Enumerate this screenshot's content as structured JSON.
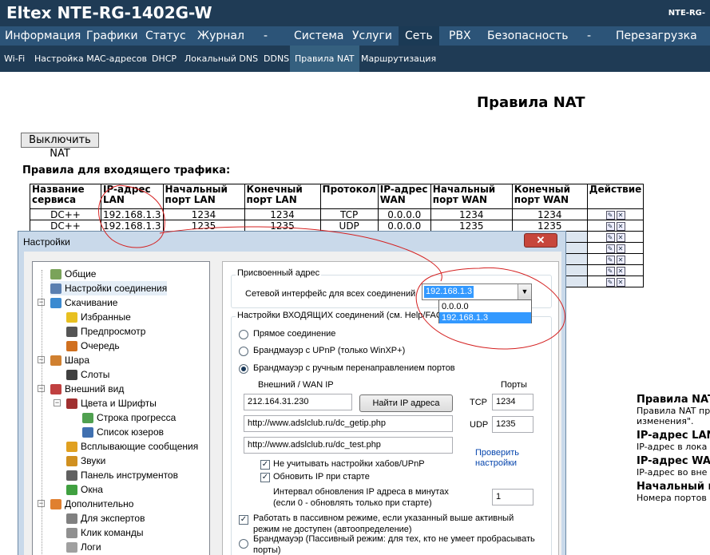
{
  "header": {
    "logo": "Eltex NTE-RG-1402G-W",
    "model_right": "NTE-RG-",
    "main_nav": [
      "Информация",
      "Графики",
      "Статус",
      "Журнал",
      "-",
      "Система",
      "Услуги",
      "Сеть",
      "PBX",
      "Безопасность",
      "-",
      "Перезагрузка"
    ],
    "active_main": "Сеть",
    "sub_nav": [
      "Wi-Fi",
      "Настройка MAC-адресов",
      "DHCP",
      "Локальный DNS",
      "DDNS",
      "Правила NAT",
      "Маршрутизация"
    ],
    "active_sub": "Правила NAT"
  },
  "page": {
    "title": "Правила NAT",
    "nat_off_button": "Выключить NAT",
    "incoming_title": "Правила для входящего трафика:"
  },
  "nat_table": {
    "headers": [
      [
        "Название",
        "сервиса"
      ],
      [
        "IP-адрес",
        "LAN"
      ],
      [
        "Начальный",
        "порт LAN"
      ],
      [
        "Конечный",
        "порт LAN"
      ],
      [
        "Протокол",
        ""
      ],
      [
        "IP-адрес",
        "WAN"
      ],
      [
        "Начальный",
        "порт WAN"
      ],
      [
        "Конечный",
        "порт WAN"
      ],
      [
        "Действие",
        ""
      ]
    ],
    "rows": [
      [
        "DC++",
        "192.168.1.3",
        "1234",
        "1234",
        "TCP",
        "0.0.0.0",
        "1234",
        "1234"
      ],
      [
        "DC++",
        "192.168.1.3",
        "1235",
        "1235",
        "UDP",
        "0.0.0.0",
        "1235",
        "1235"
      ]
    ]
  },
  "help": {
    "items": [
      {
        "h": "Правила NAT",
        "p": "Правила NAT пр"
      },
      {
        "h": "",
        "p": "изменения\"."
      },
      {
        "h": "IP-адрес LAN",
        "p": "IP-адрес в лока"
      },
      {
        "h": "IP-адрес WAN",
        "p": "IP-адрес во вне"
      },
      {
        "h": "Начальный п",
        "p": "Номера портов"
      }
    ]
  },
  "settings_window": {
    "title": "Настройки",
    "close_label": "✕",
    "tree": [
      {
        "label": "Общие",
        "level": 0,
        "icon_color": "#7aa35a"
      },
      {
        "label": "Настройки соединения",
        "level": 0,
        "icon_color": "#5a7fb0",
        "selected": true
      },
      {
        "label": "Скачивание",
        "level": 0,
        "icon_color": "#3b8ad0"
      },
      {
        "label": "Избранные",
        "level": 1,
        "icon_color": "#e8c020"
      },
      {
        "label": "Предпросмотр",
        "level": 1,
        "icon_color": "#555555"
      },
      {
        "label": "Очередь",
        "level": 1,
        "icon_color": "#d07020"
      },
      {
        "label": "Шара",
        "level": 0,
        "icon_color": "#d08030"
      },
      {
        "label": "Слоты",
        "level": 1,
        "icon_color": "#404040"
      },
      {
        "label": "Внешний вид",
        "level": 0,
        "icon_color": "#c04040"
      },
      {
        "label": "Цвета и Шрифты",
        "level": 1,
        "icon_color": "#a03030"
      },
      {
        "label": "Строка прогресса",
        "level": 2,
        "icon_color": "#50a050"
      },
      {
        "label": "Список юзеров",
        "level": 2,
        "icon_color": "#4070b0"
      },
      {
        "label": "Всплывающие сообщения",
        "level": 1,
        "icon_color": "#e0a020"
      },
      {
        "label": "Звуки",
        "level": 1,
        "icon_color": "#d09020"
      },
      {
        "label": "Панель инструментов",
        "level": 1,
        "icon_color": "#606060"
      },
      {
        "label": "Окна",
        "level": 1,
        "icon_color": "#40a040"
      },
      {
        "label": "Дополнительно",
        "level": 0,
        "icon_color": "#e08030"
      },
      {
        "label": "Для экспертов",
        "level": 1,
        "icon_color": "#808080"
      },
      {
        "label": "Клик команды",
        "level": 1,
        "icon_color": "#909090"
      },
      {
        "label": "Логи",
        "level": 1,
        "icon_color": "#a0a0a0"
      }
    ],
    "assigned_group": "Присвоенный адрес",
    "iface_label": "Сетевой интерфейс для всех соединений",
    "iface_selected": "192.168.1.3",
    "iface_options": [
      "0.0.0.0",
      "192.168.1.3"
    ],
    "incoming_group": "Настройки ВХОДЯЩИХ соединений (см. Help/FAQ)",
    "radio_direct": "Прямое соединение",
    "radio_upnp": "Брандмауэр с UPnP (только WinXP+)",
    "radio_manual": "Брандмауэр с ручным перенаправлением портов",
    "ext_ip_label": "Внешний / WAN IP",
    "ports_label": "Порты",
    "ext_ip_value": "212.164.31.230",
    "find_ip_button": "Найти IP адреса",
    "tcp_label": "TCP",
    "tcp_value": "1234",
    "udp_label": "UDP",
    "udp_value": "1235",
    "getip_url": "http://www.adslclub.ru/dc_getip.php",
    "test_url": "http://www.adslclub.ru/dc_test.php",
    "check_link": "Проверить настройки",
    "chk_ignore_hubs": "Не учитывать настройки хабов/UPnP",
    "chk_update_ip": "Обновить IP при старте",
    "interval_label_1": "Интервал обновления IP адреса в минутах",
    "interval_label_2": "(если 0 - обновлять только при старте)",
    "interval_value": "1",
    "chk_passive_1": "Работать в пассивном режиме, если указанный выше активный",
    "chk_passive_2": "режим не доступен (автоопределение)",
    "radio_passive_1": "Брандмауэр (Пассивный режим: для тех, кто не умеет пробрасывать",
    "radio_passive_2": "порты)"
  }
}
